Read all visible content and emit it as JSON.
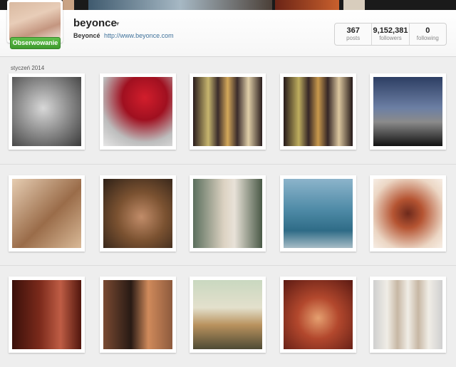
{
  "profile": {
    "username": "beyonce",
    "display_name": "Beyoncé",
    "website": "http://www.beyonce.com",
    "follow_label": "Obserwowanie",
    "stats": [
      {
        "value": "367",
        "label": "posts"
      },
      {
        "value": "9,152,381",
        "label": "followers"
      },
      {
        "value": "0",
        "label": "following"
      }
    ]
  },
  "feed": {
    "month_label": "styczeń 2014"
  },
  "colors": {
    "follow_green": "#4cae38",
    "link_blue": "#3f729b"
  }
}
